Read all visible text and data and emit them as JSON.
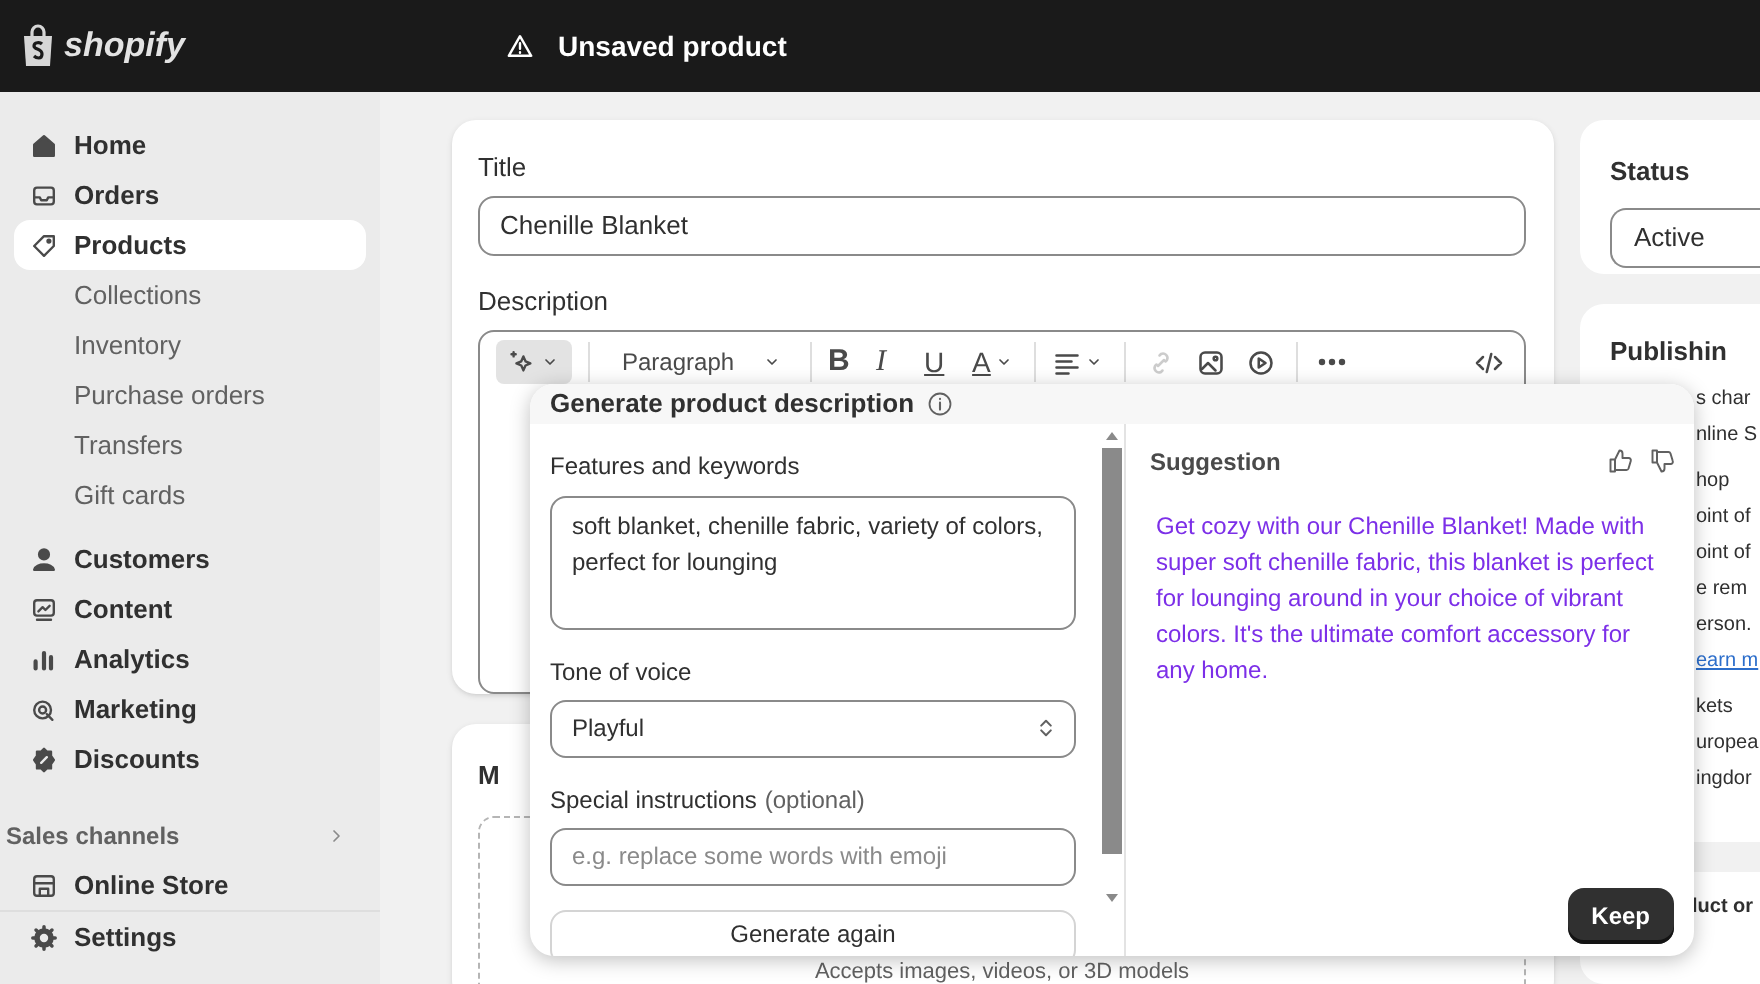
{
  "topbar": {
    "logo": "shopify",
    "title": "Unsaved product"
  },
  "sidebar": {
    "items": [
      {
        "label": "Home",
        "kind": "main",
        "selected": false
      },
      {
        "label": "Orders",
        "kind": "main",
        "selected": false
      },
      {
        "label": "Products",
        "kind": "main",
        "selected": true
      },
      {
        "label": "Collections",
        "kind": "sub",
        "selected": false
      },
      {
        "label": "Inventory",
        "kind": "sub",
        "selected": false
      },
      {
        "label": "Purchase orders",
        "kind": "sub",
        "selected": false
      },
      {
        "label": "Transfers",
        "kind": "sub",
        "selected": false
      },
      {
        "label": "Gift cards",
        "kind": "sub",
        "selected": false
      },
      {
        "label": "Customers",
        "kind": "main",
        "selected": false
      },
      {
        "label": "Content",
        "kind": "main",
        "selected": false
      },
      {
        "label": "Analytics",
        "kind": "main",
        "selected": false
      },
      {
        "label": "Marketing",
        "kind": "main",
        "selected": false
      },
      {
        "label": "Discounts",
        "kind": "main",
        "selected": false
      }
    ],
    "sales_channels": {
      "label": "Sales channels",
      "items": [
        {
          "label": "Online Store",
          "selected": false
        }
      ]
    },
    "settings": {
      "label": "Settings"
    }
  },
  "product": {
    "title_label": "Title",
    "title_value": "Chenille Blanket",
    "description_label": "Description",
    "toolbar": {
      "paragraph": "Paragraph",
      "format_buttons": [
        "B",
        "I",
        "U",
        "A"
      ],
      "link_disabled": true
    },
    "media": {
      "heading": "M",
      "hint": "Accepts images, videos, or 3D models"
    }
  },
  "generator": {
    "title": "Generate product description",
    "features_label": "Features and keywords",
    "features_value": "soft blanket, chenille fabric, variety of colors, perfect for lounging",
    "tone_label": "Tone of voice",
    "tone_value": "Playful",
    "special_label": "Special instructions",
    "special_optional": "(optional)",
    "special_placeholder": "e.g. replace some words with emoji",
    "generate_button": "Generate again",
    "suggestion_label": "Suggestion",
    "suggestion_text": "Get cozy with our Chenille Blanket! Made with super soft chenille fabric, this blanket is perfect for lounging around in your choice of vibrant colors. It's the ultimate comfort accessory for any home.",
    "keep_button": "Keep"
  },
  "right": {
    "status_label": "Status",
    "status_value": "Active",
    "publishing_title": "Publishin",
    "publishing_lines": [
      {
        "text": "s char",
        "kind": "text"
      },
      {
        "text": "nline S",
        "kind": "text"
      },
      {
        "text": "hop",
        "kind": "text"
      },
      {
        "text": "oint of",
        "kind": "text"
      },
      {
        "text": "oint of",
        "kind": "text"
      },
      {
        "text": "e rem",
        "kind": "text"
      },
      {
        "text": "erson.",
        "kind": "text"
      },
      {
        "text": "earn m",
        "kind": "link"
      },
      {
        "text": "kets",
        "kind": "text"
      },
      {
        "text": "uropea",
        "kind": "text"
      },
      {
        "text": "ingdor",
        "kind": "text"
      }
    ],
    "organization_title": "luct or"
  }
}
